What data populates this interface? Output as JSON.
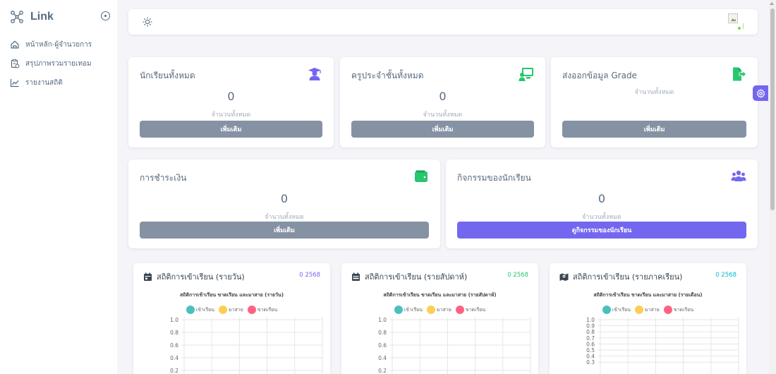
{
  "app": {
    "brand": "Link"
  },
  "sidebar": {
    "items": [
      {
        "label": "หน้าหลัก-ผู้จำนวยการ",
        "icon": "home-icon"
      },
      {
        "label": "สรุปภาพรวมรายเทอม",
        "icon": "clipboard-icon"
      },
      {
        "label": "รายงานสถิติ",
        "icon": "chart-icon"
      }
    ]
  },
  "cards": {
    "students": {
      "title": "นักเรียนทั้งหมด",
      "value": "0",
      "caption": "จำนวนทั้งหมด",
      "button": "เพิ่มเติม",
      "icon": "graduate-icon"
    },
    "teachers": {
      "title": "ครูประจำชั้นทั้งหมด",
      "value": "0",
      "caption": "จำนวนทั้งหมด",
      "button": "เพิ่มเติม",
      "icon": "teacher-board-icon"
    },
    "grade": {
      "title": "ส่งออกข้อมูล Grade",
      "caption": "จำนวนทั้งหมด",
      "button": "เพิ่มเติม",
      "icon": "file-export-icon"
    },
    "payment": {
      "title": "การชำระเงิน",
      "value": "0",
      "caption": "จำนวนทั้งหมด",
      "button": "เพิ่มเติม",
      "icon": "wallet-icon"
    },
    "activities": {
      "title": "กิจกรรมของนักเรียน",
      "value": "0",
      "caption": "จำนวนทั้งหมด",
      "button": "ดูกิจกรรมของนักเรียน",
      "icon": "users-icon"
    }
  },
  "colors": {
    "primary": "#7367f0",
    "secondary": "#8592a3",
    "success": "#28c76f",
    "info": "#00cfe8",
    "badge_daily": "#7367f0",
    "badge_weekly": "#28c76f",
    "badge_term": "#00bad1",
    "legend_present": "#4bc0c0",
    "legend_late": "#ffcd56",
    "legend_absent": "#ff6384"
  },
  "charts": [
    {
      "title": "สถิติการเข้าเรียน (รายวัน)",
      "badge": "0 2568",
      "subtitle": "สถิติการเข้าเรียน ขาดเรียน และมาสาย (รายวัน)",
      "icon": "calendar-day-icon"
    },
    {
      "title": "สถิติการเข้าเรียน (รายสัปดาห์)",
      "badge": "0 2568",
      "subtitle": "สถิติการเข้าเรียน ขาดเรียน และมาสาย (รายสัปดาห์)",
      "icon": "calendar-week-icon"
    },
    {
      "title": "สถิติการเข้าเรียน (รายภาคเรียน)",
      "badge": "0 2568",
      "subtitle": "สถิติการเข้าเรียน ขาดเรียน และมาสาย (รายเดือน)",
      "icon": "map-icon"
    }
  ],
  "chart_data": [
    {
      "type": "bar",
      "title": "สถิติการเข้าเรียน ขาดเรียน และมาสาย (รายวัน)",
      "series": [
        {
          "name": "เข้าเรียน",
          "values": []
        },
        {
          "name": "มาสาย",
          "values": []
        },
        {
          "name": "ขาดเรียน",
          "values": []
        }
      ],
      "ylim": [
        0,
        1.0
      ],
      "yticks": [
        "1.0",
        "0.8",
        "0.6",
        "0.4",
        "0.2"
      ],
      "grid": true,
      "legend": "top"
    },
    {
      "type": "bar",
      "title": "สถิติการเข้าเรียน ขาดเรียน และมาสาย (รายสัปดาห์)",
      "series": [
        {
          "name": "เข้าเรียน",
          "values": []
        },
        {
          "name": "มาสาย",
          "values": []
        },
        {
          "name": "ขาดเรียน",
          "values": []
        }
      ],
      "ylim": [
        0,
        1.0
      ],
      "yticks": [
        "1.0",
        "0.8",
        "0.6",
        "0.4",
        "0.2"
      ],
      "grid": true,
      "legend": "top"
    },
    {
      "type": "bar",
      "title": "สถิติการเข้าเรียน ขาดเรียน และมาสาย (รายเดือน)",
      "series": [
        {
          "name": "เข้าเรียน",
          "values": []
        },
        {
          "name": "มาสาย",
          "values": []
        },
        {
          "name": "ขาดเรียน",
          "values": []
        }
      ],
      "ylim": [
        0,
        1.0
      ],
      "yticks": [
        "1.0",
        "0.9",
        "0.8",
        "0.7",
        "0.6",
        "0.5",
        "0.4",
        "0.3"
      ],
      "grid": true,
      "legend": "top"
    }
  ]
}
